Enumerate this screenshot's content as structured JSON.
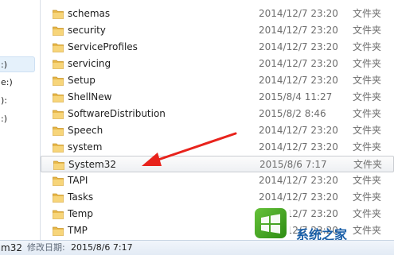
{
  "nav": {
    "items": [
      {
        "label": ":)",
        "selected": true
      },
      {
        "label": "e:)",
        "selected": false
      },
      {
        "label": "):",
        "selected": false
      },
      {
        "label": ":)",
        "selected": false
      }
    ]
  },
  "files": {
    "folder_icon_name": "folder-icon",
    "rows": [
      {
        "name": "schemas",
        "date": "2014/12/7 23:20",
        "type": "文件夹",
        "selected": false
      },
      {
        "name": "security",
        "date": "2014/12/7 23:20",
        "type": "文件夹",
        "selected": false
      },
      {
        "name": "ServiceProfiles",
        "date": "2014/12/7 23:20",
        "type": "文件夹",
        "selected": false
      },
      {
        "name": "servicing",
        "date": "2014/12/7 23:20",
        "type": "文件夹",
        "selected": false
      },
      {
        "name": "Setup",
        "date": "2014/12/7 23:20",
        "type": "文件夹",
        "selected": false
      },
      {
        "name": "ShellNew",
        "date": "2015/8/4 11:27",
        "type": "文件夹",
        "selected": false
      },
      {
        "name": "SoftwareDistribution",
        "date": "2015/8/2 8:46",
        "type": "文件夹",
        "selected": false
      },
      {
        "name": "Speech",
        "date": "2014/12/7 23:20",
        "type": "文件夹",
        "selected": false
      },
      {
        "name": "system",
        "date": "2014/12/7 23:20",
        "type": "文件夹",
        "selected": false
      },
      {
        "name": "System32",
        "date": "2015/8/6 7:17",
        "type": "文件夹",
        "selected": true
      },
      {
        "name": "TAPI",
        "date": "2014/12/7 23:20",
        "type": "文件夹",
        "selected": false
      },
      {
        "name": "Tasks",
        "date": "2014/12/7 23:20",
        "type": "文件夹",
        "selected": false
      },
      {
        "name": "Temp",
        "date": "2014/12/7 23:20",
        "type": "文件夹",
        "selected": false
      },
      {
        "name": "TMP",
        "date": "2014/12/7 23:20",
        "type": "文件夹",
        "selected": false
      }
    ]
  },
  "annotation": {
    "arrow_color": "#e8231c",
    "icon_name": "red-arrow-icon"
  },
  "watermark": {
    "text": "系统之家",
    "logo_name": "windows-logo-icon"
  },
  "status_bar": {
    "name": "m32",
    "modified_label": "修改日期:",
    "modified_value": "2015/8/6 7:17"
  },
  "colors": {
    "selection_border": "#c9ccd1",
    "secondary_text": "#6d6d6d",
    "watermark_blue": "#1a5fa8",
    "watermark_green": "#2d8c12"
  }
}
